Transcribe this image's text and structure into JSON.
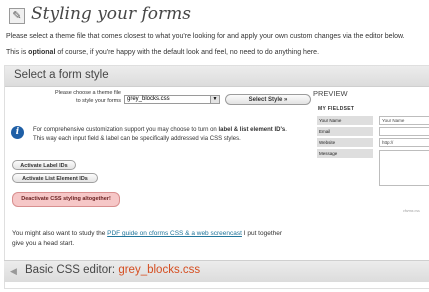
{
  "header": {
    "title": "Styling your forms",
    "intro_line_1": "Please select a theme file that comes closest to what you're looking for and apply your own custom changes via the editor below.",
    "intro_line_2_prefix": "This is ",
    "intro_line_2_bold": "optional",
    "intro_line_2_suffix": " of course, if you're happy with the default look and feel, no need to do anything here."
  },
  "panel": {
    "title": "Select a form style",
    "theme_label_1": "Please choose a theme file",
    "theme_label_2": "to style your forms",
    "theme_select_value": "grey_blocks.css",
    "select_style_button": "Select Style »",
    "info_line_1_prefix": "For comprehensive customization support you may choose to turn on ",
    "info_line_1_bold": "label & list element ID's",
    "info_line_1_suffix": ".",
    "info_line_2": "This way each input field & label can be specifically addressed via CSS styles.",
    "activate_label_ids": "Activate Label IDs",
    "activate_list_ids": "Activate List Element IDs",
    "deactivate_button": "Deactivate CSS styling altogether!",
    "study_prefix": "You might also want to study the ",
    "study_link": "PDF guide on cforms CSS & a web screencast",
    "study_suffix": " I put together",
    "study_line_2": "give you a head start."
  },
  "preview": {
    "label": "PREVIEW",
    "legend": "MY FIELDSET",
    "fields": [
      {
        "label": "Your Name",
        "value": "Your Name"
      },
      {
        "label": "Email",
        "value": ""
      },
      {
        "label": "Website",
        "value": "http://"
      },
      {
        "label": "Message",
        "value": ""
      }
    ],
    "credit": "cforms css"
  },
  "editor": {
    "title_prefix": "Basic CSS editor: ",
    "file_name": "grey_blocks.css"
  },
  "colors": {
    "link": "#21759b",
    "accent_orange": "#d54e21",
    "deactivate_bg": "#f6c7c7",
    "info_blue": "#1f5fa6"
  }
}
